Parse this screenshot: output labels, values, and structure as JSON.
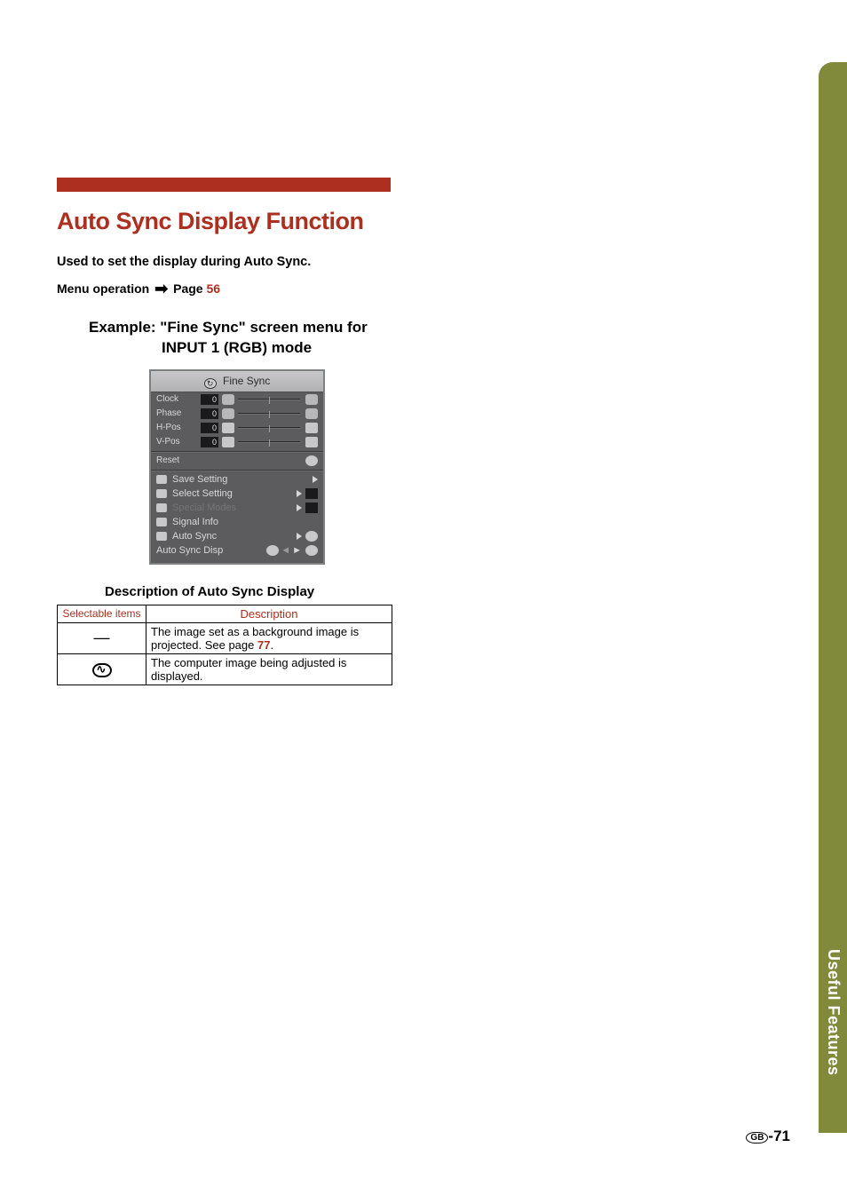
{
  "sideTab": "Useful Features",
  "title": "Auto Sync Display Function",
  "subtitle": "Used to set the display during Auto Sync.",
  "menuOp": {
    "prefix": "Menu operation",
    "page_label": "Page",
    "page_num": "56"
  },
  "example": {
    "line1": "Example: \"Fine Sync\" screen menu for",
    "line2": "INPUT 1 (RGB) mode"
  },
  "osd": {
    "header": "Fine Sync",
    "sliders": [
      {
        "label": "Clock",
        "value": "0"
      },
      {
        "label": "Phase",
        "value": "0"
      },
      {
        "label": "H-Pos",
        "value": "0"
      },
      {
        "label": "V-Pos",
        "value": "0"
      }
    ],
    "reset": "Reset",
    "items": [
      {
        "label": "Save Setting",
        "has_box": false,
        "dim": false
      },
      {
        "label": "Select Setting",
        "has_box": true,
        "dim": false
      },
      {
        "label": "Special Modes",
        "has_box": true,
        "dim": true
      },
      {
        "label": "Signal Info",
        "has_box": false,
        "dim": false,
        "no_arrow": true
      },
      {
        "label": "Auto Sync",
        "has_box": false,
        "dim": false,
        "extra_icon": true
      },
      {
        "label": "Auto Sync Disp",
        "has_box": false,
        "dim": false,
        "split": true
      }
    ]
  },
  "descTitle": "Description of Auto Sync Display",
  "table": {
    "headers": {
      "col1": "Selectable items",
      "col2": "Description"
    },
    "rows": [
      {
        "icon": "—",
        "is_dash": true,
        "desc_a": "The image set as a background image is projected. See page ",
        "page": "77",
        "desc_b": "."
      },
      {
        "icon": "wave",
        "is_dash": false,
        "desc_a": "The computer image being adjusted is displayed.",
        "page": "",
        "desc_b": ""
      }
    ]
  },
  "pageNum": {
    "region": "GB",
    "num": "-71"
  }
}
